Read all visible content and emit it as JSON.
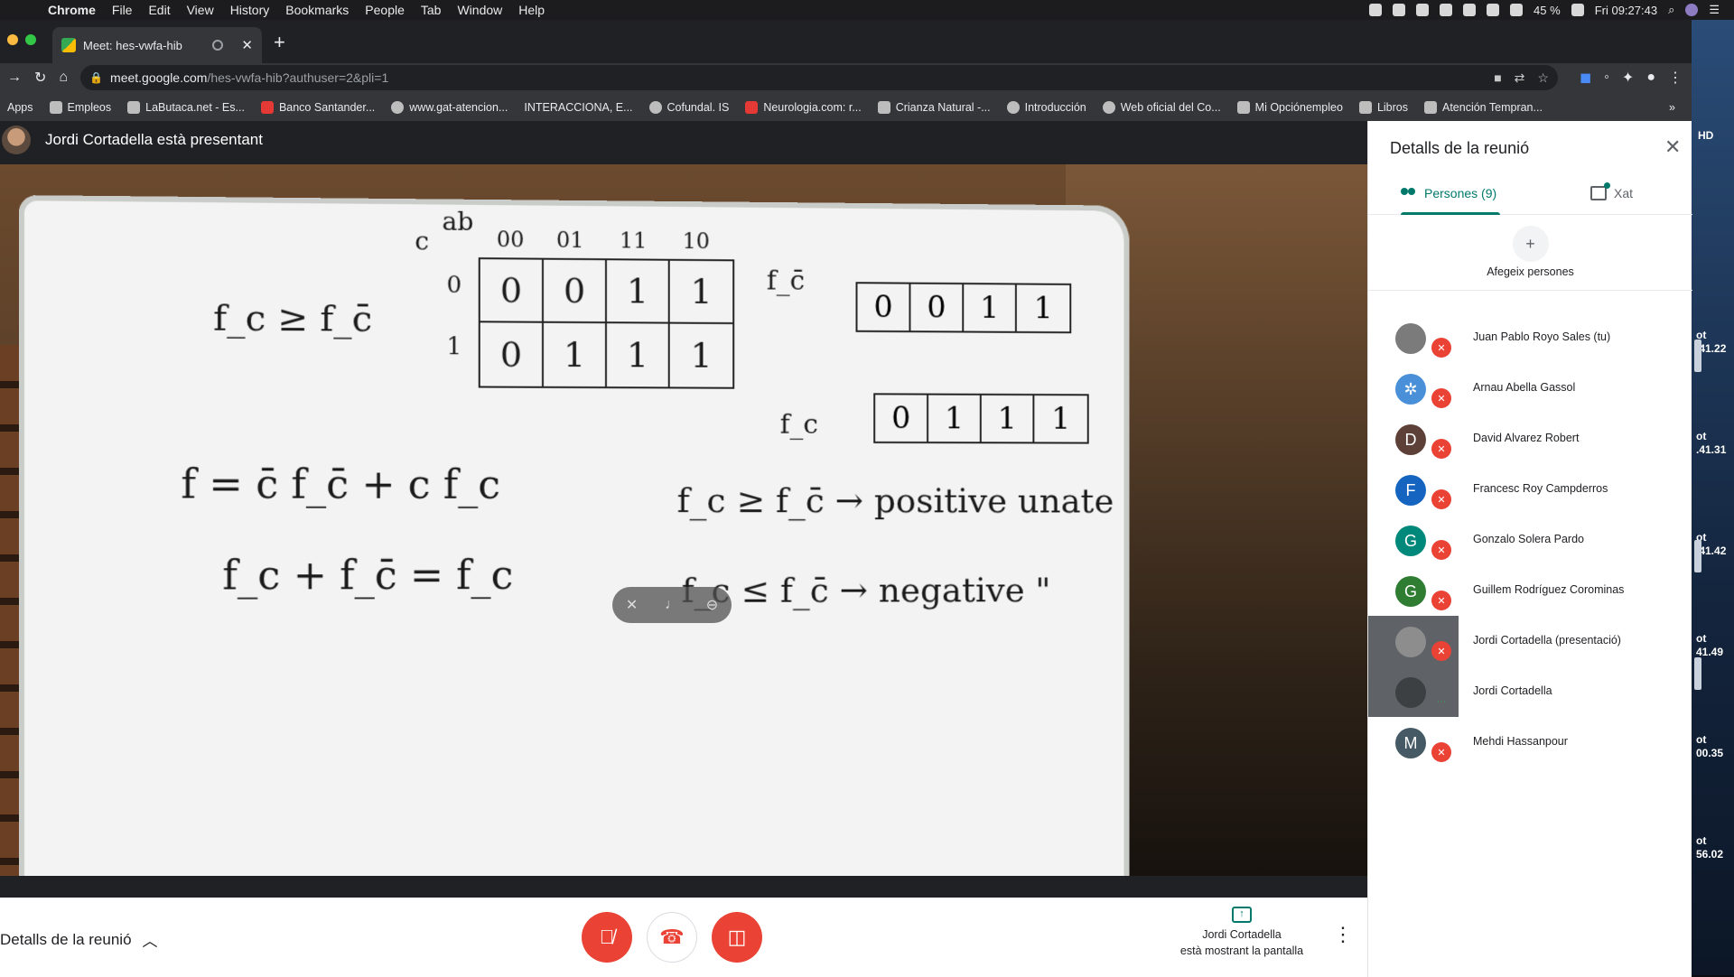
{
  "menubar": {
    "app": "Chrome",
    "items": [
      "File",
      "Edit",
      "View",
      "History",
      "Bookmarks",
      "People",
      "Tab",
      "Window",
      "Help"
    ],
    "battery": "45 %",
    "clock": "Fri 09:27:43"
  },
  "browser": {
    "tab_title": "Meet: hes-vwfa-hib",
    "url_host": "meet.google.com",
    "url_path": "/hes-vwfa-hib?authuser=2&pli=1",
    "bookmarks": [
      "Apps",
      "Empleos",
      "LaButaca.net - Es...",
      "Banco Santander...",
      "www.gat-atencion...",
      "INTERACCIONA, E...",
      "Cofundal. IS",
      "Neurologia.com: r...",
      "Crianza Natural -...",
      "Introducción",
      "Web oficial del Co...",
      "Mi Opciónempleo",
      "Libros",
      "Atención Tempran..."
    ],
    "more": "»"
  },
  "desktop": {
    "hd": "HD",
    "labels": [
      [
        "ot",
        ".41.22"
      ],
      [
        "ot",
        ".41.31"
      ],
      [
        "ot",
        ".41.42"
      ],
      [
        "ot",
        "41.49"
      ],
      [
        "ot",
        "00.35"
      ],
      [
        "ot",
        "56.02"
      ]
    ]
  },
  "meet": {
    "presenter_text": "Jordi Cortadella està presentant",
    "details_label": "Detalls de la reunió",
    "presenting_line1": "Jordi Cortadella",
    "presenting_line2": "està mostrant la pantalla"
  },
  "whiteboard": {
    "kmap_row_header": "c",
    "kmap_col_header": "ab",
    "col_labels": [
      "00",
      "01",
      "11",
      "10"
    ],
    "row_labels": [
      "0",
      "1"
    ],
    "kmap_values": [
      [
        "0",
        "0",
        "1",
        "1"
      ],
      [
        "0",
        "1",
        "1",
        "1"
      ]
    ],
    "fc_bar_label": "f_c̄",
    "fc_label": "f_c",
    "row_top": [
      "0",
      "0",
      "1",
      "1"
    ],
    "row_bottom": [
      "0",
      "1",
      "1",
      "1"
    ],
    "eq1": "f_c ≥ f_c̄",
    "eq2": "f = c̄ f_c̄ + c f_c",
    "eq3": "f_c + f_c̄ = f_c",
    "eq4": "f_c ≥ f_c̄ → positive unate",
    "eq5": "f_c ≤ f_c̄ → negative \""
  },
  "panel": {
    "title": "Detalls de la reunió",
    "tab_people": "Persones (9)",
    "tab_chat": "Xat",
    "add_people": "Afegeix persones",
    "people": [
      {
        "name": "Juan Pablo Royo Sales (tu)",
        "initial": "",
        "color": "#7b7b7b"
      },
      {
        "name": "Arnau Abella Gassol",
        "initial": "✲",
        "color": "#4a90d9"
      },
      {
        "name": "David Alvarez Robert",
        "initial": "D",
        "color": "#5d4037"
      },
      {
        "name": "Francesc Roy Campderros",
        "initial": "F",
        "color": "#1565c0"
      },
      {
        "name": "Gonzalo Solera Pardo",
        "initial": "G",
        "color": "#00897b"
      },
      {
        "name": "Guillem Rodríguez Corominas",
        "initial": "G",
        "color": "#2e7d32"
      },
      {
        "name": "Jordi Cortadella (presentació)",
        "initial": "",
        "color": "#8d8d8d"
      },
      {
        "name": "Jordi Cortadella",
        "initial": "",
        "color": "#3c4043"
      },
      {
        "name": "Mehdi Hassanpour",
        "initial": "M",
        "color": "#455a64"
      }
    ]
  },
  "colors": {
    "accent": "#00796b",
    "danger": "#ea4335"
  }
}
